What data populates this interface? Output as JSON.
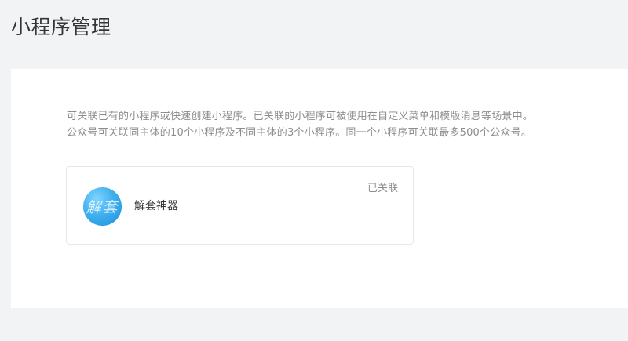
{
  "header": {
    "title": "小程序管理"
  },
  "description": {
    "line1": "可关联已有的小程序或快速创建小程序。已关联的小程序可被使用在自定义菜单和模版消息等场景中。",
    "line2": "公众号可关联同主体的10个小程序及不同主体的3个小程序。同一个小程序可关联最多500个公众号。"
  },
  "linked_apps": [
    {
      "name": "解套神器",
      "avatar_text": "解套",
      "status": "已关联"
    }
  ],
  "colors": {
    "page_background": "#f2f3f5",
    "panel_background": "#ffffff",
    "avatar_blue": "#3fb0ee"
  }
}
